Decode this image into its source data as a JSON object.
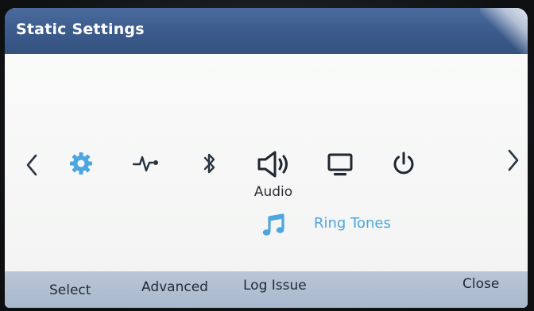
{
  "window": {
    "title": "Static Settings"
  },
  "carousel": {
    "items": [
      {
        "icon": "gear-icon",
        "label": "",
        "selected": true
      },
      {
        "icon": "heartbeat-icon",
        "label": ""
      },
      {
        "icon": "bluetooth-icon",
        "label": ""
      },
      {
        "icon": "speaker-icon",
        "label": "Audio",
        "focused": true
      },
      {
        "icon": "monitor-icon",
        "label": ""
      },
      {
        "icon": "power-icon",
        "label": ""
      }
    ]
  },
  "submenu": {
    "icon": "music-note-icon",
    "label": "Ring Tones"
  },
  "softkeys": {
    "select": "Select",
    "advanced": "Advanced",
    "log_issue": "Log Issue",
    "close": "Close"
  },
  "colors": {
    "titlebar": "#3b5a8b",
    "accent": "#4ea6e0",
    "softkey_bar": "#b0bfd2",
    "text_dark": "#1f2a38"
  }
}
